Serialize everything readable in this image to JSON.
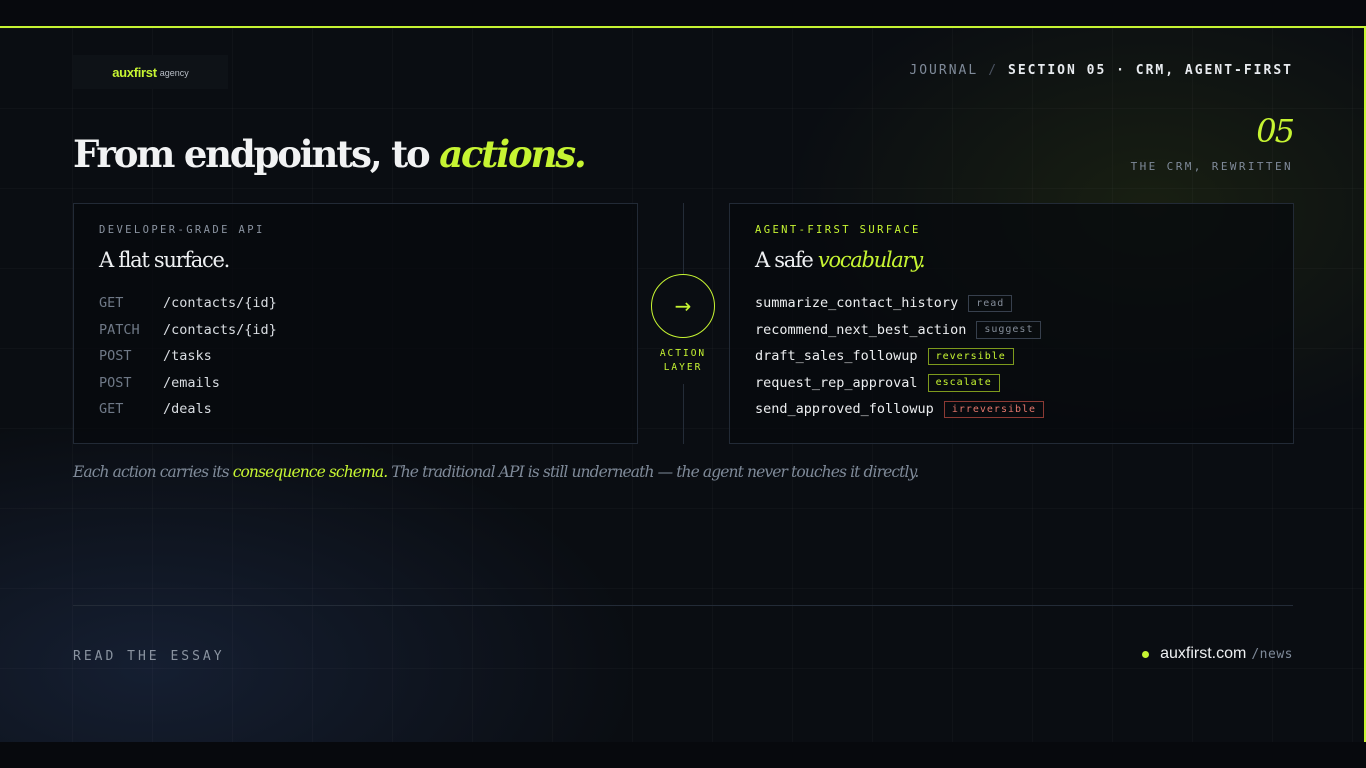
{
  "brand": {
    "name": "auxfirst",
    "suffix": "agency"
  },
  "breadcrumb": {
    "journal": "JOURNAL",
    "separator": "/",
    "section": "SECTION 05 · CRM, AGENT-FIRST"
  },
  "headline": {
    "prefix": "From endpoints, to ",
    "emphasis": "actions."
  },
  "section": {
    "number": "05",
    "subtitle": "THE CRM, REWRITTEN"
  },
  "left_panel": {
    "kicker": "DEVELOPER-GRADE API",
    "title": "A flat surface.",
    "endpoints": [
      {
        "method": "GET",
        "path": "/contacts/{id}"
      },
      {
        "method": "PATCH",
        "path": "/contacts/{id}"
      },
      {
        "method": "POST",
        "path": "/tasks"
      },
      {
        "method": "POST",
        "path": "/emails"
      },
      {
        "method": "GET",
        "path": "/deals"
      }
    ]
  },
  "connector": {
    "arrow": "→",
    "label_line1": "ACTION",
    "label_line2": "LAYER"
  },
  "right_panel": {
    "kicker": "AGENT-FIRST SURFACE",
    "title_prefix": "A safe ",
    "title_emphasis": "vocabulary.",
    "actions": [
      {
        "name": "summarize_contact_history",
        "tag": "read"
      },
      {
        "name": "recommend_next_best_action",
        "tag": "suggest"
      },
      {
        "name": "draft_sales_followup",
        "tag": "reversible"
      },
      {
        "name": "request_rep_approval",
        "tag": "escalate"
      },
      {
        "name": "send_approved_followup",
        "tag": "irreversible"
      }
    ]
  },
  "caption": {
    "prefix": "Each action carries its ",
    "emphasis": "consequence schema.",
    "suffix": " The traditional API is still underneath — the agent never touches it directly."
  },
  "footer": {
    "cta": "READ THE ESSAY",
    "domain": "auxfirst.com",
    "path": "/news"
  },
  "colors": {
    "accent": "#c6f432",
    "background": "#0a0d12",
    "danger": "#e4776c"
  }
}
